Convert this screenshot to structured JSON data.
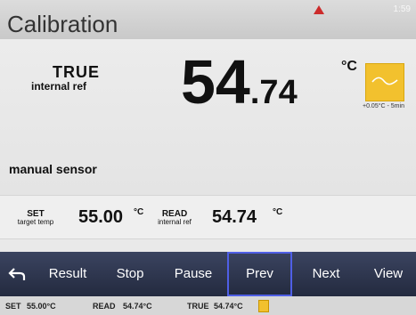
{
  "header": {
    "title": "Calibration",
    "clock": "1:59"
  },
  "main": {
    "true_title": "TRUE",
    "true_sub": "internal ref",
    "value_int": "54",
    "value_dec": ".74",
    "unit": "°C",
    "trend_label": "+0.05°C - 5min",
    "manual_label": "manual sensor"
  },
  "setrow": {
    "set_label": "SET",
    "set_sub": "target temp",
    "set_value": "55.00",
    "set_unit": "°C",
    "read_label": "READ",
    "read_sub": "internal ref",
    "read_value": "54.74",
    "read_unit": "°C"
  },
  "nav": {
    "result": "Result",
    "stop": "Stop",
    "pause": "Pause",
    "prev": "Prev",
    "next": "Next",
    "view": "View"
  },
  "status": {
    "set_label": "SET",
    "set_value": "55.00°C",
    "read_label": "READ",
    "read_value": "54.74°C",
    "true_label": "TRUE",
    "true_value": "54.74°C"
  },
  "colors": {
    "trend_tile": "#f2c12e",
    "alarm": "#cc2b2b",
    "nav_bg": "#2c3450",
    "selection": "#4f5fe6"
  }
}
